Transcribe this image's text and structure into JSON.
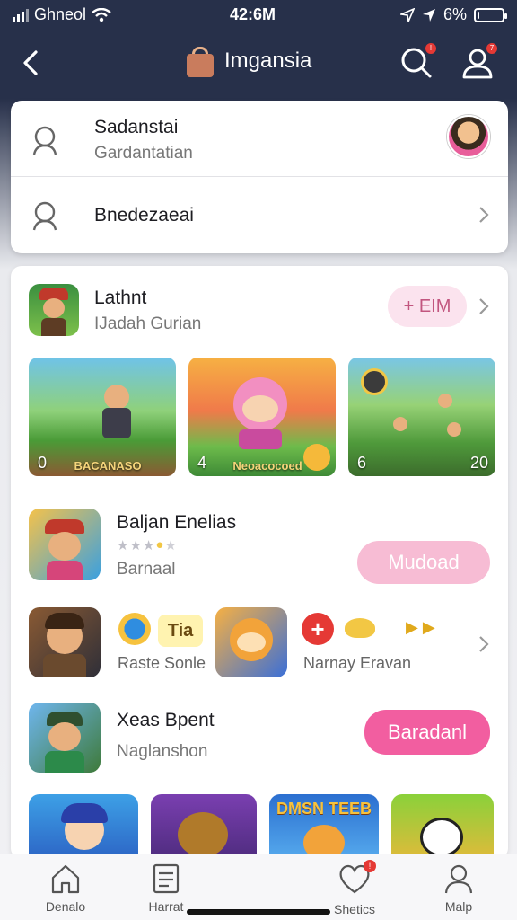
{
  "status_bar": {
    "carrier": "Ghneol",
    "time": "42:6M",
    "battery": "6%",
    "battery_level": 0.06
  },
  "header": {
    "title": "Imgansia",
    "search_badge": "!",
    "profile_badge": "7"
  },
  "account_card": {
    "primary": {
      "title": "Sadanstai",
      "subtitle": "Gardantatian"
    },
    "secondary": {
      "title": "Bnedezaeai"
    }
  },
  "featured": {
    "app": {
      "title": "Lathnt",
      "subtitle": "IJadah Gurian",
      "action_label": "+ EIM"
    },
    "thumbnails": [
      {
        "left": "0",
        "label": "BACANASO",
        "right": ""
      },
      {
        "left": "4",
        "label": "Neoacocoed",
        "right": ""
      },
      {
        "left": "6",
        "label": "",
        "right": "20"
      }
    ]
  },
  "list": [
    {
      "title": "Baljan Enelias",
      "subtitle": "Barnaal",
      "rating": 3,
      "action_label": "Mudoad"
    },
    {
      "left_caption": "Raste Sonle",
      "badge_text": "Tia",
      "right_caption": "Narnay Eravan"
    },
    {
      "title": "Xeas Bpent",
      "subtitle": "Naglanshon",
      "action_label": "Baradanl"
    }
  ],
  "bottom_row_labels": [
    "DMSN TEEB"
  ],
  "tabs": [
    {
      "label": "Denalo",
      "icon": "home-icon"
    },
    {
      "label": "Harrat",
      "icon": "list-icon"
    },
    {
      "label": "Shetics",
      "icon": "heart-icon",
      "badge": "!"
    },
    {
      "label": "Malp",
      "icon": "person-icon"
    }
  ],
  "colors": {
    "header_bg": "#27304a",
    "accent_pink": "#f25ea0",
    "accent_pink_light": "#f7bcd4",
    "badge_red": "#e53935"
  }
}
